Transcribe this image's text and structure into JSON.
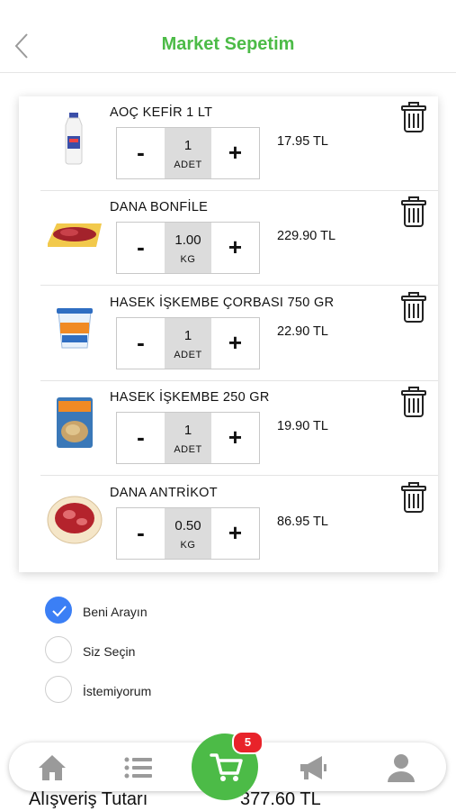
{
  "header": {
    "title": "Market Sepetim",
    "back_icon": "chevron-left-icon"
  },
  "cart": {
    "items": [
      {
        "name": "AOÇ KEFİR 1 LT",
        "quantity": "1",
        "unit": "ADET",
        "price": "17.95 TL",
        "image": "kefir-bottle-image"
      },
      {
        "name": "DANA BONFİLE",
        "quantity": "1.00",
        "unit": "KG",
        "price": "229.90 TL",
        "image": "beef-tenderloin-image"
      },
      {
        "name": "HASEK İŞKEMBE ÇORBASI 750 GR",
        "quantity": "1",
        "unit": "ADET",
        "price": "22.90 TL",
        "image": "soup-tub-image"
      },
      {
        "name": "HASEK İŞKEMBE 250 GR",
        "quantity": "1",
        "unit": "ADET",
        "price": "19.90 TL",
        "image": "tripe-pack-image"
      },
      {
        "name": "DANA ANTRİKOT",
        "quantity": "0.50",
        "unit": "KG",
        "price": "86.95 TL",
        "image": "ribeye-plate-image"
      }
    ],
    "minus_label": "-",
    "plus_label": "+"
  },
  "options": [
    {
      "label": "Beni Arayın",
      "selected": true
    },
    {
      "label": "Siz Seçin",
      "selected": false
    },
    {
      "label": "İstemiyorum",
      "selected": false
    }
  ],
  "nav": {
    "items": [
      "home-icon",
      "list-icon",
      "cart-icon",
      "megaphone-icon",
      "user-icon"
    ],
    "cart_badge": "5"
  },
  "total": {
    "label": "Alışveriş Tutarı",
    "value": "377.60 TL"
  },
  "colors": {
    "accent": "#4cbb47",
    "radio_selected": "#3b7ff5",
    "badge": "#e8232a"
  }
}
